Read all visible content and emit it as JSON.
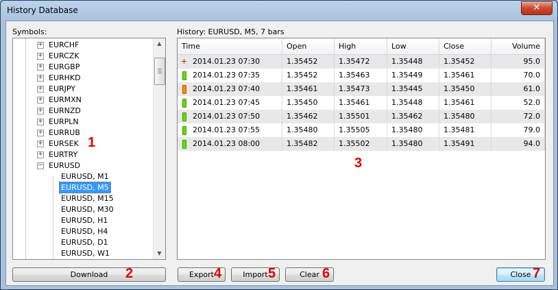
{
  "window": {
    "title": "History Database",
    "close_glyph": "✕"
  },
  "symbols": {
    "label": "Symbols:",
    "items": [
      {
        "label": "EURCHF",
        "type": "symbol"
      },
      {
        "label": "EURCZK",
        "type": "symbol"
      },
      {
        "label": "EURGBP",
        "type": "symbol"
      },
      {
        "label": "EURHKD",
        "type": "symbol"
      },
      {
        "label": "EURJPY",
        "type": "symbol"
      },
      {
        "label": "EURMXN",
        "type": "symbol"
      },
      {
        "label": "EURNZD",
        "type": "symbol"
      },
      {
        "label": "EURPLN",
        "type": "symbol"
      },
      {
        "label": "EURRUB",
        "type": "symbol"
      },
      {
        "label": "EURSEK",
        "type": "symbol"
      },
      {
        "label": "EURTRY",
        "type": "symbol"
      },
      {
        "label": "EURUSD",
        "type": "symbol-expanded"
      },
      {
        "label": "EURUSD, M1",
        "type": "timeframe"
      },
      {
        "label": "EURUSD, M5",
        "type": "timeframe",
        "selected": true
      },
      {
        "label": "EURUSD, M15",
        "type": "timeframe"
      },
      {
        "label": "EURUSD, M30",
        "type": "timeframe"
      },
      {
        "label": "EURUSD, H1",
        "type": "timeframe"
      },
      {
        "label": "EURUSD, H4",
        "type": "timeframe"
      },
      {
        "label": "EURUSD, D1",
        "type": "timeframe"
      },
      {
        "label": "EURUSD, W1",
        "type": "timeframe"
      }
    ],
    "expand_glyph": "+",
    "collapse_glyph": "−",
    "scroll_up_glyph": "▲",
    "scroll_down_glyph": "▼"
  },
  "history": {
    "label": "History: EURUSD, M5, 7 bars",
    "columns": [
      "Time",
      "Open",
      "High",
      "Low",
      "Close",
      "Volume"
    ],
    "rows": [
      {
        "candle": "doji",
        "time": "2014.01.23 07:30",
        "open": "1.35452",
        "high": "1.35472",
        "low": "1.35448",
        "close": "1.35452",
        "volume": "95.0"
      },
      {
        "candle": "bull",
        "time": "2014.01.23 07:35",
        "open": "1.35452",
        "high": "1.35463",
        "low": "1.35449",
        "close": "1.35461",
        "volume": "70.0"
      },
      {
        "candle": "bear",
        "time": "2014.01.23 07:40",
        "open": "1.35461",
        "high": "1.35473",
        "low": "1.35445",
        "close": "1.35450",
        "volume": "61.0"
      },
      {
        "candle": "bull",
        "time": "2014.01.23 07:45",
        "open": "1.35450",
        "high": "1.35461",
        "low": "1.35448",
        "close": "1.35461",
        "volume": "52.0"
      },
      {
        "candle": "bull",
        "time": "2014.01.23 07:50",
        "open": "1.35462",
        "high": "1.35501",
        "low": "1.35462",
        "close": "1.35480",
        "volume": "72.0"
      },
      {
        "candle": "bull",
        "time": "2014.01.23 07:55",
        "open": "1.35480",
        "high": "1.35505",
        "low": "1.35480",
        "close": "1.35481",
        "volume": "79.0"
      },
      {
        "candle": "bull",
        "time": "2014.01.23 08:00",
        "open": "1.35482",
        "high": "1.35502",
        "low": "1.35480",
        "close": "1.35491",
        "volume": "94.0"
      }
    ]
  },
  "buttons": {
    "download": "Download",
    "export": "Export",
    "import": "Import",
    "clear": "Clear",
    "close": "Close"
  },
  "callouts": [
    "1",
    "2",
    "3",
    "4",
    "5",
    "6",
    "7"
  ],
  "colors": {
    "callout": "#e00000",
    "selection": "#3399ff",
    "bull": "#66dd00",
    "bear": "#ff8800",
    "doji": "#cc2200"
  }
}
